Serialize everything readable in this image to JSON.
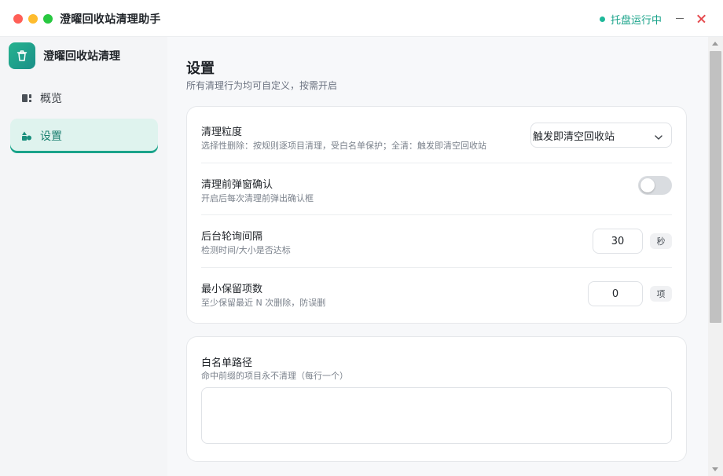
{
  "app": {
    "title": "澄曜回收站清理助手",
    "tray_status": "托盘运行中",
    "accent_color": "#1aa38a"
  },
  "sidebar": {
    "brand_name": "澄曜回收站清理",
    "brand_icon": "trash-bin-icon",
    "items": [
      {
        "label": "概览",
        "icon": "dashboard-icon",
        "active": false
      },
      {
        "label": "设置",
        "icon": "settings-shapes-icon",
        "active": true
      }
    ]
  },
  "page": {
    "title": "设置",
    "subtitle": "所有清理行为均可自定义，按需开启"
  },
  "settings": {
    "granularity": {
      "title": "清理粒度",
      "desc": "选择性删除：按规则逐项目清理，受白名单保护；全清：触发即清空回收站",
      "selected": "触发即清空回收站"
    },
    "confirm": {
      "title": "清理前弹窗确认",
      "desc": "开启后每次清理前弹出确认框",
      "enabled": false
    },
    "poll": {
      "title": "后台轮询间隔",
      "desc": "检测时间/大小是否达标",
      "value": "30",
      "unit": "秒"
    },
    "min_keep": {
      "title": "最小保留项数",
      "desc": "至少保留最近 N 次删除，防误删",
      "value": "0",
      "unit": "项"
    }
  },
  "whitelist": {
    "title": "白名单路径",
    "desc": "命中前缀的项目永不清理（每行一个）",
    "value": ""
  }
}
